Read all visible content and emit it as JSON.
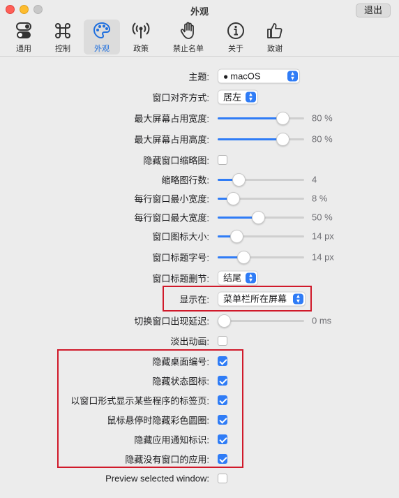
{
  "window": {
    "title": "外观",
    "quit_label": "退出"
  },
  "toolbar": {
    "tabs": [
      {
        "label": "通用",
        "icon": "toggles-icon"
      },
      {
        "label": "控制",
        "icon": "command-icon"
      },
      {
        "label": "外观",
        "icon": "palette-icon",
        "active": true
      },
      {
        "label": "政策",
        "icon": "antenna-icon"
      },
      {
        "label": "禁止名单",
        "icon": "hand-icon"
      },
      {
        "label": "关于",
        "icon": "info-icon"
      },
      {
        "label": "致谢",
        "icon": "thumbs-up-icon"
      }
    ]
  },
  "settings": {
    "theme": {
      "label": "主题:",
      "value": "macOS"
    },
    "alignment": {
      "label": "窗口对齐方式:",
      "value": "居左"
    },
    "max_width": {
      "label": "最大屏幕占用宽度:",
      "value": "80 %",
      "fraction": 0.8
    },
    "max_height": {
      "label": "最大屏幕占用高度:",
      "value": "80 %",
      "fraction": 0.8
    },
    "hide_thumbnails": {
      "label": "隐藏窗口缩略图:",
      "checked": false
    },
    "thumb_rows": {
      "label": "缩略图行数:",
      "value": "4",
      "fraction": 0.2
    },
    "min_width": {
      "label": "每行窗口最小宽度:",
      "value": "8 %",
      "fraction": 0.12
    },
    "max_row_width": {
      "label": "每行窗口最大宽度:",
      "value": "50 %",
      "fraction": 0.47
    },
    "icon_size": {
      "label": "窗口图标大小:",
      "value": "14 px",
      "fraction": 0.17
    },
    "title_font": {
      "label": "窗口标题字号:",
      "value": "14 px",
      "fraction": 0.27
    },
    "title_truncation": {
      "label": "窗口标题删节:",
      "value": "结尾"
    },
    "show_on": {
      "label": "显示在:",
      "value": "菜单栏所在屏幕"
    },
    "delay": {
      "label": "切换窗口出现延迟:",
      "value": "0 ms",
      "fraction": 0.0
    },
    "fade": {
      "label": "淡出动画:",
      "checked": false
    },
    "hide_space_number": {
      "label": "隐藏桌面编号:",
      "checked": true
    },
    "hide_status_icons": {
      "label": "隐藏状态图标:",
      "checked": true
    },
    "show_tabs": {
      "label": "以窗口形式显示某些程序的标签页:",
      "checked": true
    },
    "hide_colored_circles": {
      "label": "鼠标悬停时隐藏彩色圆圈:",
      "checked": true
    },
    "hide_badges": {
      "label": "隐藏应用通知标识:",
      "checked": true
    },
    "hide_windowless": {
      "label": "隐藏没有窗口的应用:",
      "checked": true
    },
    "preview_selected": {
      "label": "Preview selected window:",
      "checked": false
    }
  },
  "colors": {
    "accent": "#2f7cf6",
    "highlight": "#d0192a"
  }
}
